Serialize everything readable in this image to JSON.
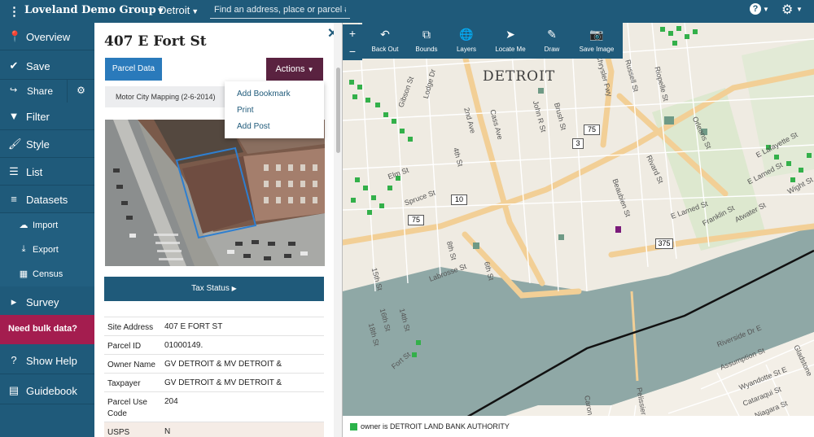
{
  "topbar": {
    "group": "Loveland Demo Group",
    "city": "Detroit",
    "search_placeholder": "Find an address, place or parcel #",
    "help_icon": "question-circle-icon",
    "settings_icon": "gear-icon"
  },
  "nav": {
    "overview": "Overview",
    "save": "Save",
    "share": "Share",
    "filter": "Filter",
    "style": "Style",
    "list": "List",
    "datasets": "Datasets",
    "import": "Import",
    "export": "Export",
    "census": "Census",
    "survey": "Survey",
    "bulk": "Need bulk data?",
    "help": "Show Help",
    "guidebook": "Guidebook"
  },
  "panel": {
    "title": "407 E Fort St",
    "parcel_data": "Parcel Data",
    "actions": "Actions",
    "image_source": "Motor City Mapping (2-6-2014)",
    "actions_menu": [
      "Add Bookmark",
      "Print",
      "Add Post"
    ],
    "tax_status": "Tax Status",
    "attributes": [
      {
        "key": "Site Address",
        "value": "407 E FORT ST"
      },
      {
        "key": "Parcel ID",
        "value": "01000149."
      },
      {
        "key": "Owner Name",
        "value": "GV DETROIT & MV DETROIT &"
      },
      {
        "key": "Taxpayer",
        "value": "GV DETROIT & MV DETROIT &"
      },
      {
        "key": "Parcel Use Code",
        "value": "204"
      },
      {
        "key": "USPS",
        "value": "N"
      }
    ]
  },
  "map": {
    "zoom_in": "+",
    "zoom_out": "−",
    "tools": [
      {
        "label": "Back Out",
        "icon": "undo-arrow-icon"
      },
      {
        "label": "Bounds",
        "icon": "bounds-icon"
      },
      {
        "label": "Layers",
        "icon": "globe-icon"
      },
      {
        "label": "Locate Me",
        "icon": "location-arrow-icon"
      },
      {
        "label": "Draw",
        "icon": "pencil-icon"
      },
      {
        "label": "Save Image",
        "icon": "camera-icon"
      }
    ],
    "city_label": "DETROIT",
    "shields": [
      "75",
      "3",
      "10",
      "75",
      "375"
    ],
    "streets": [
      "Gibson St",
      "Lodge Dr",
      "Chrysler Fwy",
      "Russell St",
      "Riopelle St",
      "Orleans St",
      "E Lafayette St",
      "E Larned St",
      "Wight St",
      "E Larned St",
      "Franklin St",
      "Atwater St",
      "Rivard St",
      "Beaubien St",
      "Brush St",
      "John R St",
      "Cass Ave",
      "2nd Ave",
      "4th St",
      "Elm St",
      "Spruce St",
      "8th St",
      "6th St",
      "Labrosse St",
      "15th St",
      "16th St",
      "18th St",
      "14th St",
      "Fort St",
      "Riverside Dr E",
      "Assumption St",
      "Wyandotte St E",
      "Cataraqui St",
      "Niagara St",
      "Gladstone",
      "Pelissier",
      "Caron"
    ],
    "legend": "owner is DETROIT LAND BANK AUTHORITY"
  },
  "colors": {
    "nav_blue": "#1f5a7a",
    "actions_purple": "#5a2240",
    "parcel_button_blue": "#2a7abb",
    "bulk_magenta": "#a41d4f",
    "land_bank_green": "#2bb34a",
    "river": "#8fa8a6"
  }
}
